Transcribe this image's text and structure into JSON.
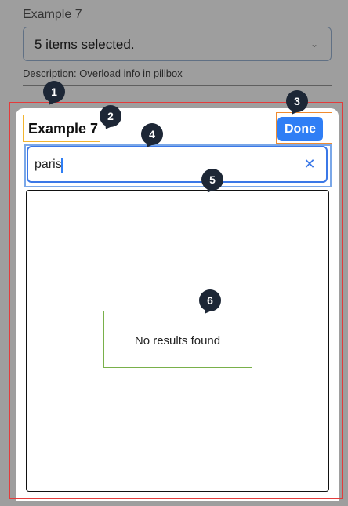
{
  "background": {
    "field_label": "Example 7",
    "select_value": "5 items selected.",
    "description": "Description: Overload info in pillbox"
  },
  "sheet": {
    "title": "Example 7",
    "done_label": "Done",
    "search_value": "paris",
    "no_results_text": "No results found"
  },
  "markers": [
    "1",
    "2",
    "3",
    "4",
    "5",
    "6"
  ],
  "colors": {
    "accent": "#2f7ef5",
    "marker_bg": "#1d2736",
    "annotation_red": "#e33b3b",
    "annotation_yellow": "#f2b530",
    "annotation_orange": "#f08b2f",
    "annotation_green": "#79b04a"
  },
  "icons": {
    "clear": "close-icon",
    "dropdown": "chevron-down-icon"
  }
}
